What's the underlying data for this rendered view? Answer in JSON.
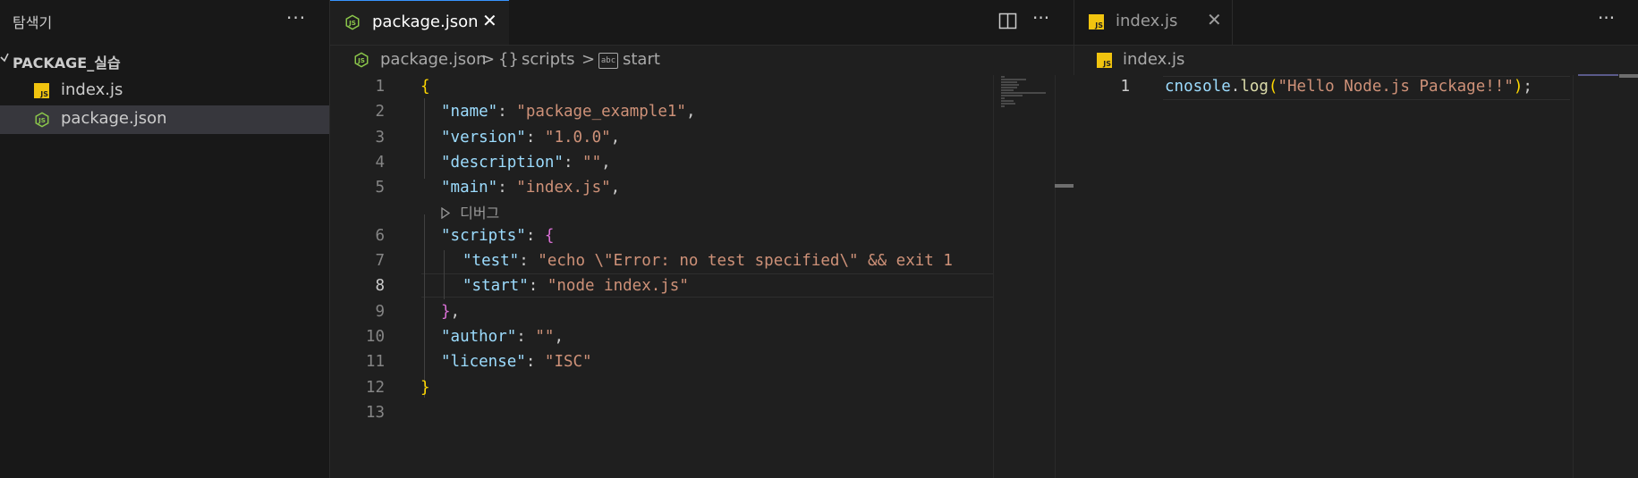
{
  "explorer": {
    "title": "탐색기",
    "more": "···",
    "folder": {
      "chevron": "✓",
      "name": "PACKAGE_실습"
    },
    "files": [
      {
        "name": "index.js",
        "icon": "js-file-icon"
      },
      {
        "name": "package.json",
        "icon": "nodejs-file-icon",
        "selected": true
      }
    ]
  },
  "editor_left": {
    "tab": {
      "label": "package.json",
      "close": "✕"
    },
    "more": "···",
    "breadcrumb": {
      "file": "package.json",
      "sep": ">",
      "section_icon": "{}",
      "section": "scripts",
      "leaf_icon": "abc",
      "leaf": "start"
    },
    "codelens": "디버그",
    "line_numbers": [
      "1",
      "2",
      "3",
      "4",
      "5",
      "6",
      "7",
      "8",
      "9",
      "10",
      "11",
      "12",
      "13"
    ],
    "lines": {
      "l1": {
        "b": "{"
      },
      "l2": {
        "k": "\"name\"",
        "p": ": ",
        "v": "\"package_example1\"",
        "e": ","
      },
      "l3": {
        "k": "\"version\"",
        "p": ": ",
        "v": "\"1.0.0\"",
        "e": ","
      },
      "l4": {
        "k": "\"description\"",
        "p": ": ",
        "v": "\"\"",
        "e": ","
      },
      "l5": {
        "k": "\"main\"",
        "p": ": ",
        "v": "\"index.js\"",
        "e": ","
      },
      "l6": {
        "k": "\"scripts\"",
        "p": ": ",
        "b": "{"
      },
      "l7": {
        "k": "\"test\"",
        "p": ": ",
        "v": "\"echo \\\"Error: no test specified\\\" && exit 1",
        "e": ""
      },
      "l8": {
        "k": "\"start\"",
        "p": ": ",
        "v": "\"node index.js\""
      },
      "l9": {
        "b": "}",
        "e": ","
      },
      "l10": {
        "k": "\"author\"",
        "p": ": ",
        "v": "\"\"",
        "e": ","
      },
      "l11": {
        "k": "\"license\"",
        "p": ": ",
        "v": "\"ISC\""
      },
      "l12": {
        "b": "}"
      }
    }
  },
  "editor_right": {
    "tab": {
      "label": "index.js",
      "close": "✕"
    },
    "more": "···",
    "breadcrumb": {
      "file": "index.js"
    },
    "line_numbers": [
      "1"
    ],
    "line1": {
      "obj": "cnosole",
      "dot": ".",
      "fn": "log",
      "open": "(",
      "str": "\"Hello Node.js Package!!\"",
      "close": ")",
      "semi": ";"
    }
  },
  "colors": {
    "accent": "#3794ff",
    "key": "#9cdcfe",
    "string": "#ce9178",
    "bracket1": "#ffd700",
    "bracket2": "#da70d6",
    "function": "#dcdcaa"
  }
}
